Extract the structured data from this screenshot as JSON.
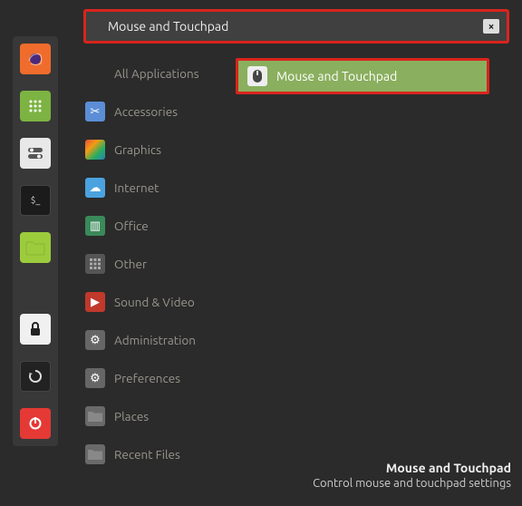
{
  "taskbar": {
    "items": [
      {
        "name": "firefox-icon"
      },
      {
        "name": "apps-icon"
      },
      {
        "name": "settings-icon"
      },
      {
        "name": "terminal-icon"
      },
      {
        "name": "files-icon"
      },
      {
        "name": "lock-icon"
      },
      {
        "name": "update-icon"
      },
      {
        "name": "power-icon"
      }
    ]
  },
  "search": {
    "value": "Mouse and Touchpad",
    "clear_label": "×"
  },
  "categories": [
    {
      "label": "All Applications",
      "icon": "all",
      "color": "transparent"
    },
    {
      "label": "Accessories",
      "icon": "scissors",
      "color": "#5b8ed6"
    },
    {
      "label": "Graphics",
      "icon": "palette",
      "color": "linear"
    },
    {
      "label": "Internet",
      "icon": "cloud",
      "color": "#4aa3df"
    },
    {
      "label": "Office",
      "icon": "doc",
      "color": "#3a8a5a"
    },
    {
      "label": "Other",
      "icon": "grid",
      "color": "#555"
    },
    {
      "label": "Sound & Video",
      "icon": "play",
      "color": "#c0392b"
    },
    {
      "label": "Administration",
      "icon": "gear",
      "color": "#666"
    },
    {
      "label": "Preferences",
      "icon": "gear",
      "color": "#666"
    },
    {
      "label": "Places",
      "icon": "folder",
      "color": "#6a6a6a"
    },
    {
      "label": "Recent Files",
      "icon": "folder",
      "color": "#6a6a6a"
    }
  ],
  "results": [
    {
      "label": "Mouse and Touchpad",
      "icon": "mouse"
    }
  ],
  "footer": {
    "title": "Mouse and Touchpad",
    "description": "Control mouse and touchpad settings"
  }
}
